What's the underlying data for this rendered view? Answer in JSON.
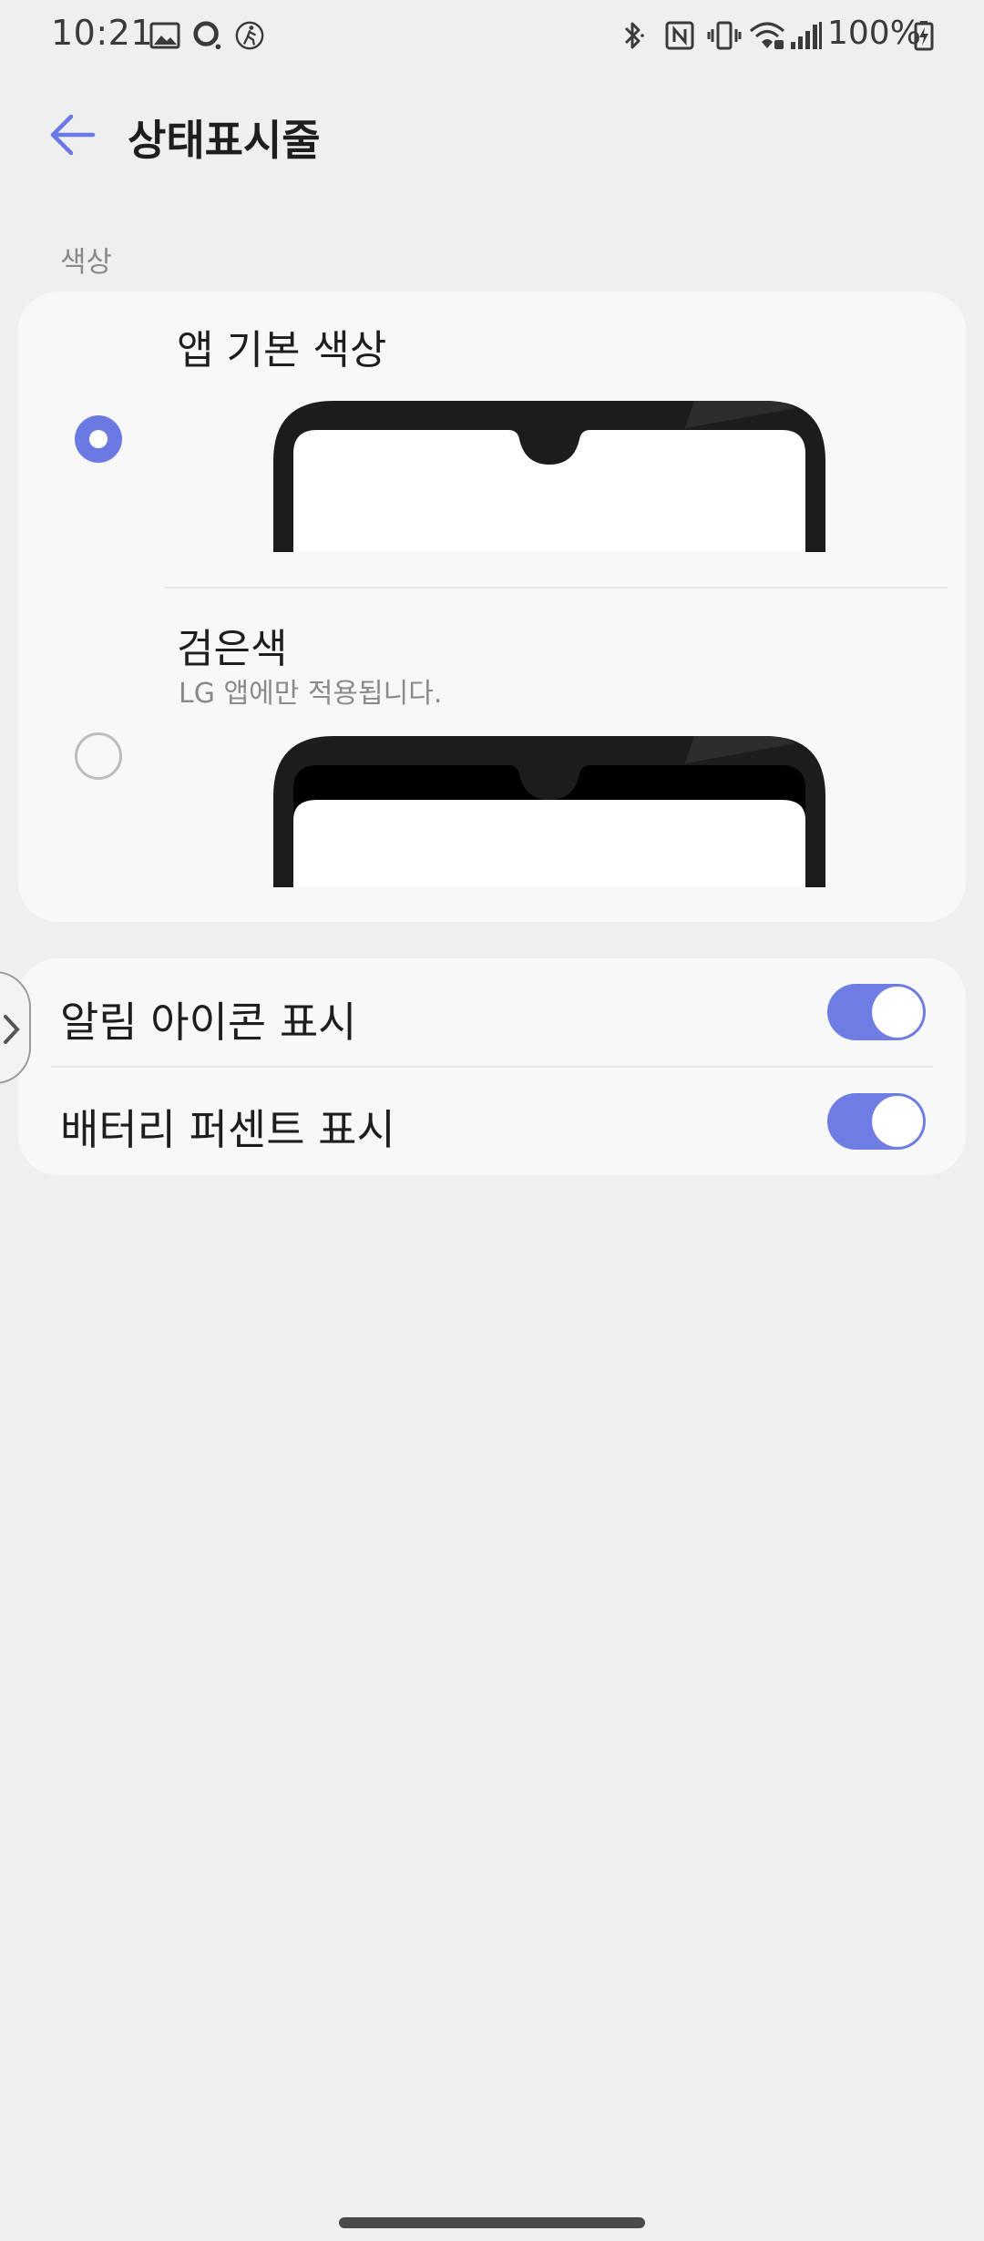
{
  "status_bar": {
    "time": "10:21",
    "battery": "100%",
    "icons": [
      "gallery-icon",
      "circle-app-icon",
      "walking-icon",
      "bluetooth-icon",
      "nfc-icon",
      "vibrate-icon",
      "wifi-icon",
      "signal-icon",
      "battery-charging-icon"
    ]
  },
  "header": {
    "title": "상태표시줄",
    "back_icon": "back-arrow-icon",
    "accent": "#6c79e2"
  },
  "color_section": {
    "label": "색상",
    "options": [
      {
        "title": "앱 기본 색상",
        "subtitle": "",
        "selected": true
      },
      {
        "title": "검은색",
        "subtitle": "LG 앱에만 적용됩니다.",
        "selected": false
      }
    ]
  },
  "toggles": [
    {
      "label": "알림 아이콘 표시",
      "on": true
    },
    {
      "label": "배터리 퍼센트 표시",
      "on": true
    }
  ]
}
